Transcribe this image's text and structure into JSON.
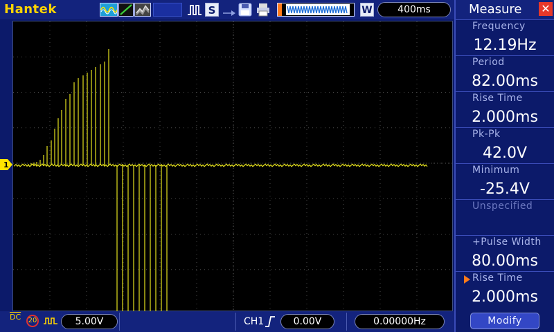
{
  "brand": "Hantek",
  "toolbar": {
    "run_mode_letter": "S",
    "acq_mode_letter": "W",
    "timebase": "400ms"
  },
  "bottom": {
    "coupling": "DC",
    "bw_limit": "20",
    "ch1_scale": "5.00V",
    "trigger_source": "CH1",
    "trigger_level": "0.00V",
    "frequency": "0.00000Hz"
  },
  "panel": {
    "title": "Measure",
    "close_symbol": "✕",
    "slots": [
      {
        "label": "Frequency",
        "value": "12.19Hz"
      },
      {
        "label": "Period",
        "value": "82.00ms"
      },
      {
        "label": "Rise Time",
        "value": "2.000ms"
      },
      {
        "label": "Pk-Pk",
        "value": "42.0V"
      },
      {
        "label": "Minimum",
        "value": "-25.4V"
      },
      {
        "label": "Unspecified",
        "value": ""
      },
      {
        "label": "+Pulse Width",
        "value": "80.00ms"
      },
      {
        "label": "Rise Time",
        "value": "2.000ms"
      }
    ],
    "modify_label": "Modify"
  },
  "colors": {
    "background": "#0c1a6a",
    "trace": "#e6e21e",
    "brand": "#ffd400",
    "accent_orange": "#ff7a1a",
    "close_red": "#e6382a"
  },
  "icons": [
    "waveform-icon",
    "slope-icon",
    "persistence-icon",
    "run-icon",
    "save-icon",
    "print-icon",
    "trigger-position-icon",
    "dc-coupling-icon",
    "bandwidth-limit-icon",
    "ac-icon",
    "rising-edge-icon",
    "ground-marker-icon"
  ]
}
